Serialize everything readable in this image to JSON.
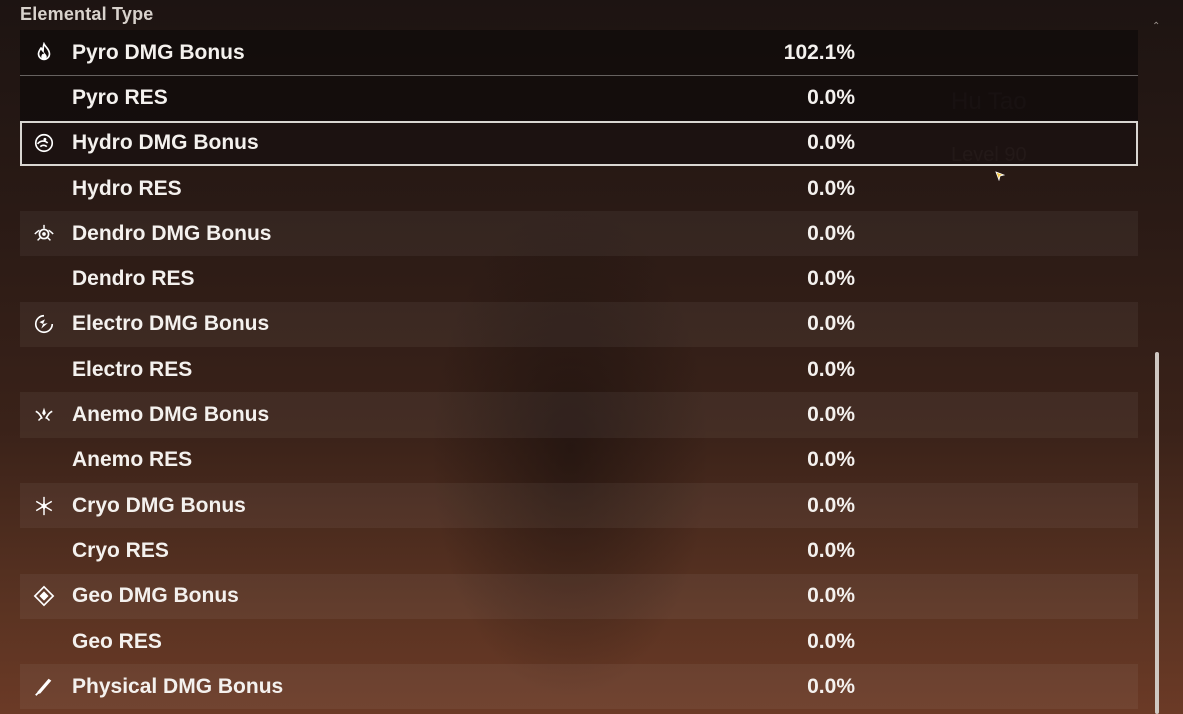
{
  "section": {
    "title": "Elemental Type"
  },
  "background": {
    "character_name": "Hu Tao",
    "level_text": "Level 90"
  },
  "rows": [
    {
      "icon": "pyro-icon",
      "label": "Pyro DMG Bonus",
      "value": "102.1%"
    },
    {
      "icon": "",
      "label": "Pyro RES",
      "value": "0.0%"
    },
    {
      "icon": "hydro-icon",
      "label": "Hydro DMG Bonus",
      "value": "0.0%"
    },
    {
      "icon": "",
      "label": "Hydro RES",
      "value": "0.0%"
    },
    {
      "icon": "dendro-icon",
      "label": "Dendro DMG Bonus",
      "value": "0.0%"
    },
    {
      "icon": "",
      "label": "Dendro RES",
      "value": "0.0%"
    },
    {
      "icon": "electro-icon",
      "label": "Electro DMG Bonus",
      "value": "0.0%"
    },
    {
      "icon": "",
      "label": "Electro RES",
      "value": "0.0%"
    },
    {
      "icon": "anemo-icon",
      "label": "Anemo DMG Bonus",
      "value": "0.0%"
    },
    {
      "icon": "",
      "label": "Anemo RES",
      "value": "0.0%"
    },
    {
      "icon": "cryo-icon",
      "label": "Cryo DMG Bonus",
      "value": "0.0%"
    },
    {
      "icon": "",
      "label": "Cryo RES",
      "value": "0.0%"
    },
    {
      "icon": "geo-icon",
      "label": "Geo DMG Bonus",
      "value": "0.0%"
    },
    {
      "icon": "",
      "label": "Geo RES",
      "value": "0.0%"
    },
    {
      "icon": "physical-icon",
      "label": "Physical DMG Bonus",
      "value": "0.0%"
    }
  ],
  "selected_index": 2,
  "colors": {
    "text": "#f4f1ee",
    "selected_outline": "#d9d6d2",
    "scroll_thumb": "#cfc8c2"
  }
}
